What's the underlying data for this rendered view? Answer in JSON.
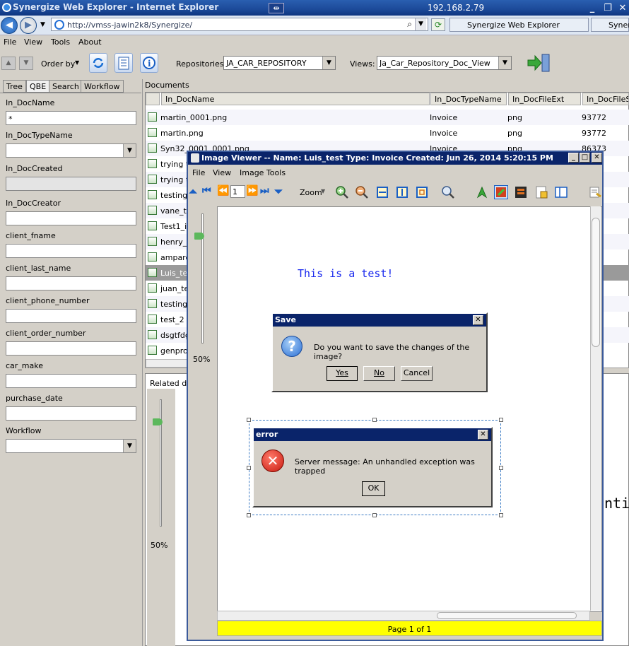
{
  "browser": {
    "title": "Synergize Web Explorer - Internet Explorer",
    "remote_host": "192.168.2.79",
    "url": "http://vmss-jawin2k8/Synergize/",
    "tabs": [
      "Synergize Web Explorer",
      "Syner"
    ],
    "window_controls": [
      "_",
      "❐",
      "✕"
    ],
    "pin_glyph": "⇹"
  },
  "app_menu": [
    "File",
    "View",
    "Tools",
    "About"
  ],
  "toolbar": {
    "order_by_label": "Order by",
    "repositories_label": "Repositories:",
    "repository_value": "JA_CAR_REPOSITORY",
    "views_label": "Views:",
    "view_value": "Ja_Car_Repository_Doc_View"
  },
  "left_tabs": [
    "Tree",
    "QBE",
    "Search",
    "Workflow"
  ],
  "qbe": {
    "fields": [
      {
        "label": "In_DocName",
        "value": "*"
      },
      {
        "label": "In_DocTypeName",
        "value": ""
      },
      {
        "label": "In_DocCreated",
        "value": ""
      },
      {
        "label": "In_DocCreator",
        "value": ""
      },
      {
        "label": "client_fname",
        "value": ""
      },
      {
        "label": "client_last_name",
        "value": ""
      },
      {
        "label": "client_phone_number",
        "value": ""
      },
      {
        "label": "client_order_number",
        "value": ""
      },
      {
        "label": "car_make",
        "value": ""
      },
      {
        "label": "purchase_date",
        "value": ""
      },
      {
        "label": "Workflow",
        "value": ""
      }
    ]
  },
  "documents": {
    "label": "Documents",
    "columns": [
      "In_DocName",
      "In_DocTypeName",
      "In_DocFileExt",
      "In_DocFileSiz"
    ],
    "rows": [
      {
        "name": "martin_0001.png",
        "type": "Invoice",
        "ext": "png",
        "size": "93772"
      },
      {
        "name": "martin.png",
        "type": "Invoice",
        "ext": "png",
        "size": "93772"
      },
      {
        "name": "Syn32_0001_0001.png",
        "type": "Invoice",
        "ext": "png",
        "size": "86373"
      },
      {
        "name": "trying to",
        "type": "",
        "ext": "",
        "size": ""
      },
      {
        "name": "trying to",
        "type": "",
        "ext": "",
        "size": ""
      },
      {
        "name": "testing_",
        "type": "",
        "ext": "",
        "size": ""
      },
      {
        "name": "vane_te",
        "type": "",
        "ext": "",
        "size": ""
      },
      {
        "name": "Test1_i",
        "type": "",
        "ext": "",
        "size": ""
      },
      {
        "name": "henry_",
        "type": "",
        "ext": "",
        "size": ""
      },
      {
        "name": "amparo",
        "type": "",
        "ext": "",
        "size": ""
      },
      {
        "name": "Luis_te",
        "type": "",
        "ext": "",
        "size": ""
      },
      {
        "name": "juan_te",
        "type": "",
        "ext": "",
        "size": ""
      },
      {
        "name": "testing_",
        "type": "",
        "ext": "",
        "size": ""
      },
      {
        "name": "test_2",
        "type": "",
        "ext": "",
        "size": ""
      },
      {
        "name": "dsgtfdg",
        "type": "",
        "ext": "",
        "size": ""
      },
      {
        "name": "genprov",
        "type": "",
        "ext": "",
        "size": ""
      }
    ],
    "selected_index": 10,
    "related_label": "Related do",
    "zoom": "50%",
    "partial_text": "ntit"
  },
  "image_viewer": {
    "title": "Image Viewer -- Name: Luis_test Type: Invoice Created: Jun 26, 2014 5:20:15 PM",
    "menu": [
      "File",
      "View",
      "Image Tools"
    ],
    "page_input": "1",
    "zoom_label": "Zoom",
    "zoom": "50%",
    "canvas_text": "This is a test!",
    "page_status": "Page 1 of 1"
  },
  "save_dialog": {
    "title": "Save",
    "message": "Do you want to save the changes of the image?",
    "buttons": [
      "Yes",
      "No",
      "Cancel"
    ]
  },
  "error_dialog": {
    "title": "error",
    "message": "Server message: An unhandled exception was trapped",
    "button": "OK"
  }
}
